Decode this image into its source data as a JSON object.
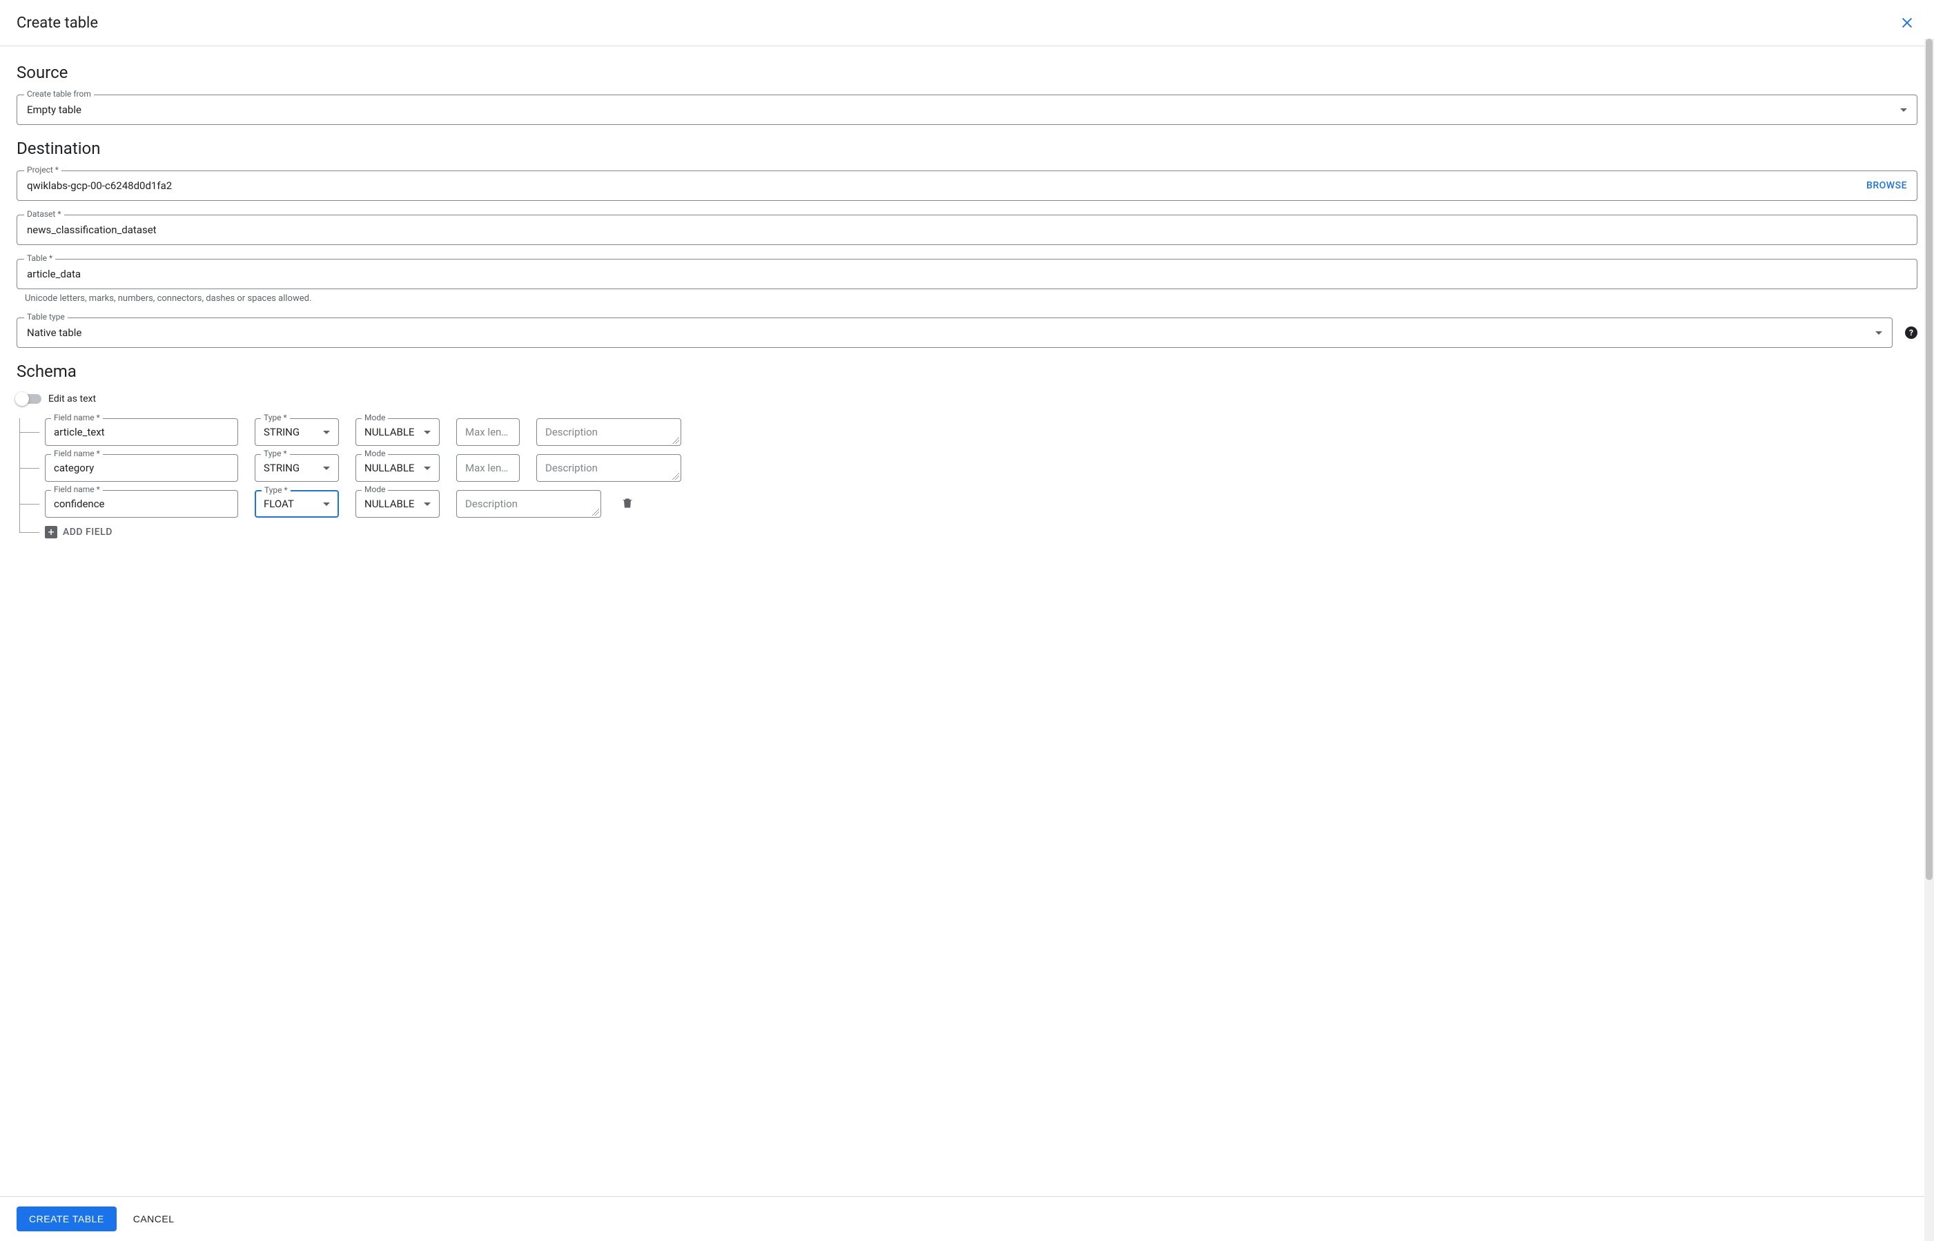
{
  "modal": {
    "title": "Create table"
  },
  "source": {
    "header": "Source",
    "create_from_label": "Create table from",
    "create_from_value": "Empty table"
  },
  "destination": {
    "header": "Destination",
    "project_label": "Project",
    "project_value": "qwiklabs-gcp-00-c6248d0d1fa2",
    "browse_label": "BROWSE",
    "dataset_label": "Dataset",
    "dataset_value": "news_classification_dataset",
    "table_label": "Table",
    "table_value": "article_data",
    "table_hint": "Unicode letters, marks, numbers, connectors, dashes or spaces allowed.",
    "tabletype_label": "Table type",
    "tabletype_value": "Native table"
  },
  "schema": {
    "header": "Schema",
    "edit_as_text_label": "Edit as text",
    "field_name_label": "Field name",
    "type_label": "Type",
    "mode_label": "Mode",
    "maxlen_placeholder": "Max len…",
    "description_placeholder": "Description",
    "add_field_label": "ADD FIELD",
    "rows": [
      {
        "name": "article_text",
        "type": "STRING",
        "mode": "NULLABLE",
        "show_maxlen": true,
        "show_delete": false,
        "type_focused": false
      },
      {
        "name": "category",
        "type": "STRING",
        "mode": "NULLABLE",
        "show_maxlen": true,
        "show_delete": false,
        "type_focused": false
      },
      {
        "name": "confidence",
        "type": "FLOAT",
        "mode": "NULLABLE",
        "show_maxlen": false,
        "show_delete": true,
        "type_focused": true
      }
    ]
  },
  "footer": {
    "create_label": "CREATE TABLE",
    "cancel_label": "CANCEL"
  }
}
